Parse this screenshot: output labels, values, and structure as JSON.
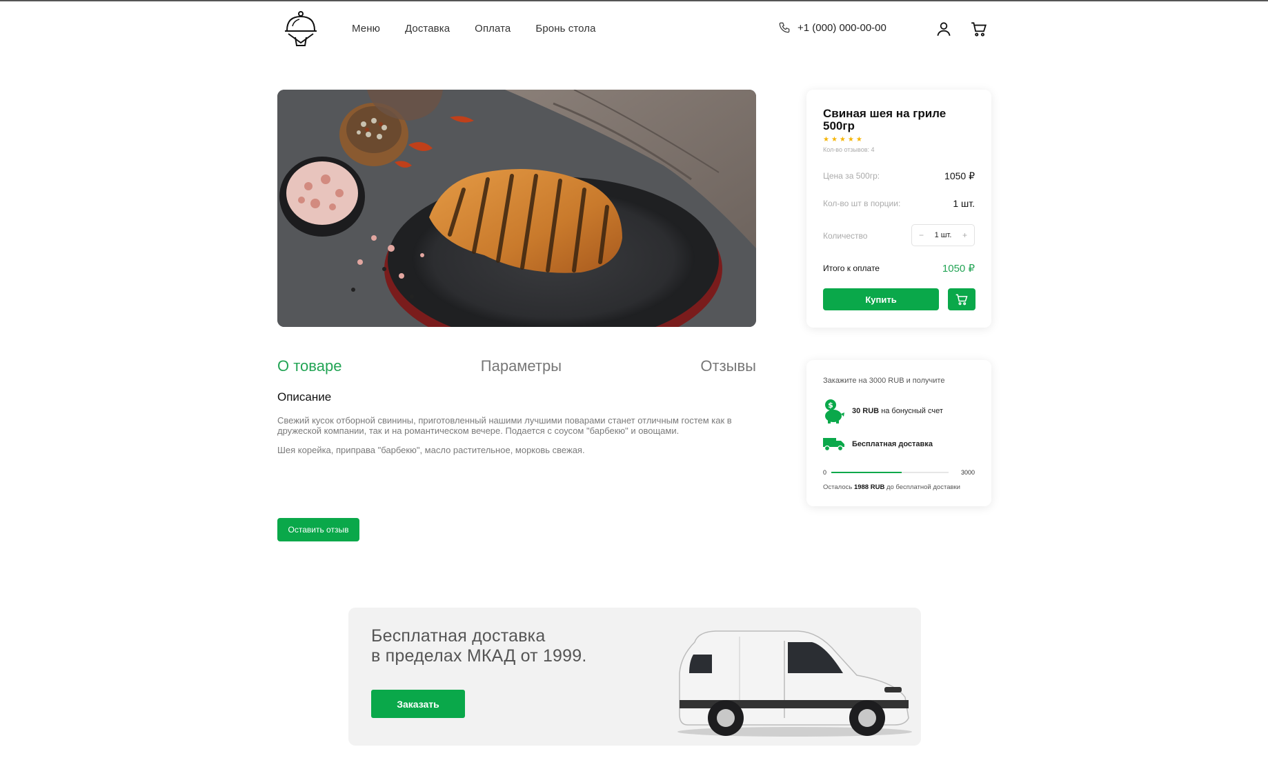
{
  "header": {
    "nav": [
      "Меню",
      "Доставка",
      "Оплата",
      "Бронь стола"
    ],
    "phone": "+1 (000) 000-00-00"
  },
  "tabs": [
    "О товаре",
    "Параметры",
    "Отзывы"
  ],
  "description": {
    "title": "Описание",
    "text": "Свежий кусок отборной свинины, приготовленный нашими лучшими поварами станет отличным гостем как в дружеской компании, так и на романтическом вечере. Подается с соусом \"барбекю\" и овощами.",
    "ingredients": "Шея корейка, приправа \"барбекю\", масло растительное, морковь свежая."
  },
  "review_button": "Оставить отзыв",
  "product": {
    "title": "Свиная шея на гриле 500гр",
    "stars": "★★★★★",
    "rating": 5,
    "reviews": "Кол-во отзывов: 4",
    "price_label": "Цена за 500гр:",
    "price": "1050 ₽",
    "portion_label": "Кол-во шт в порции:",
    "portion": "1 шт.",
    "qty_label": "Количество",
    "qty_minus": "−",
    "qty": "1 шт.",
    "qty_plus": "+",
    "total_label": "Итого к оплате",
    "total": "1050 ₽",
    "buy": "Купить"
  },
  "bonus": {
    "heading": "Закажите на 3000 RUB и получите",
    "bonus_amount": "30 RUB",
    "bonus_text": "на бонусный счет",
    "delivery_text": "Бесплатная доставка",
    "min": "0",
    "max": "3000",
    "progress": 0.6,
    "remain_prefix": "Осталось",
    "remain_amount": "1988 RUB",
    "remain_suffix": "до бесплатной доставки"
  },
  "banner": {
    "line1": "Бесплатная доставка",
    "line2": "в пределах МКАД от 1999.",
    "button": "Заказать"
  },
  "colors": {
    "accent": "#0aa84a",
    "accent_text": "#23a455",
    "star": "#f5b400"
  }
}
